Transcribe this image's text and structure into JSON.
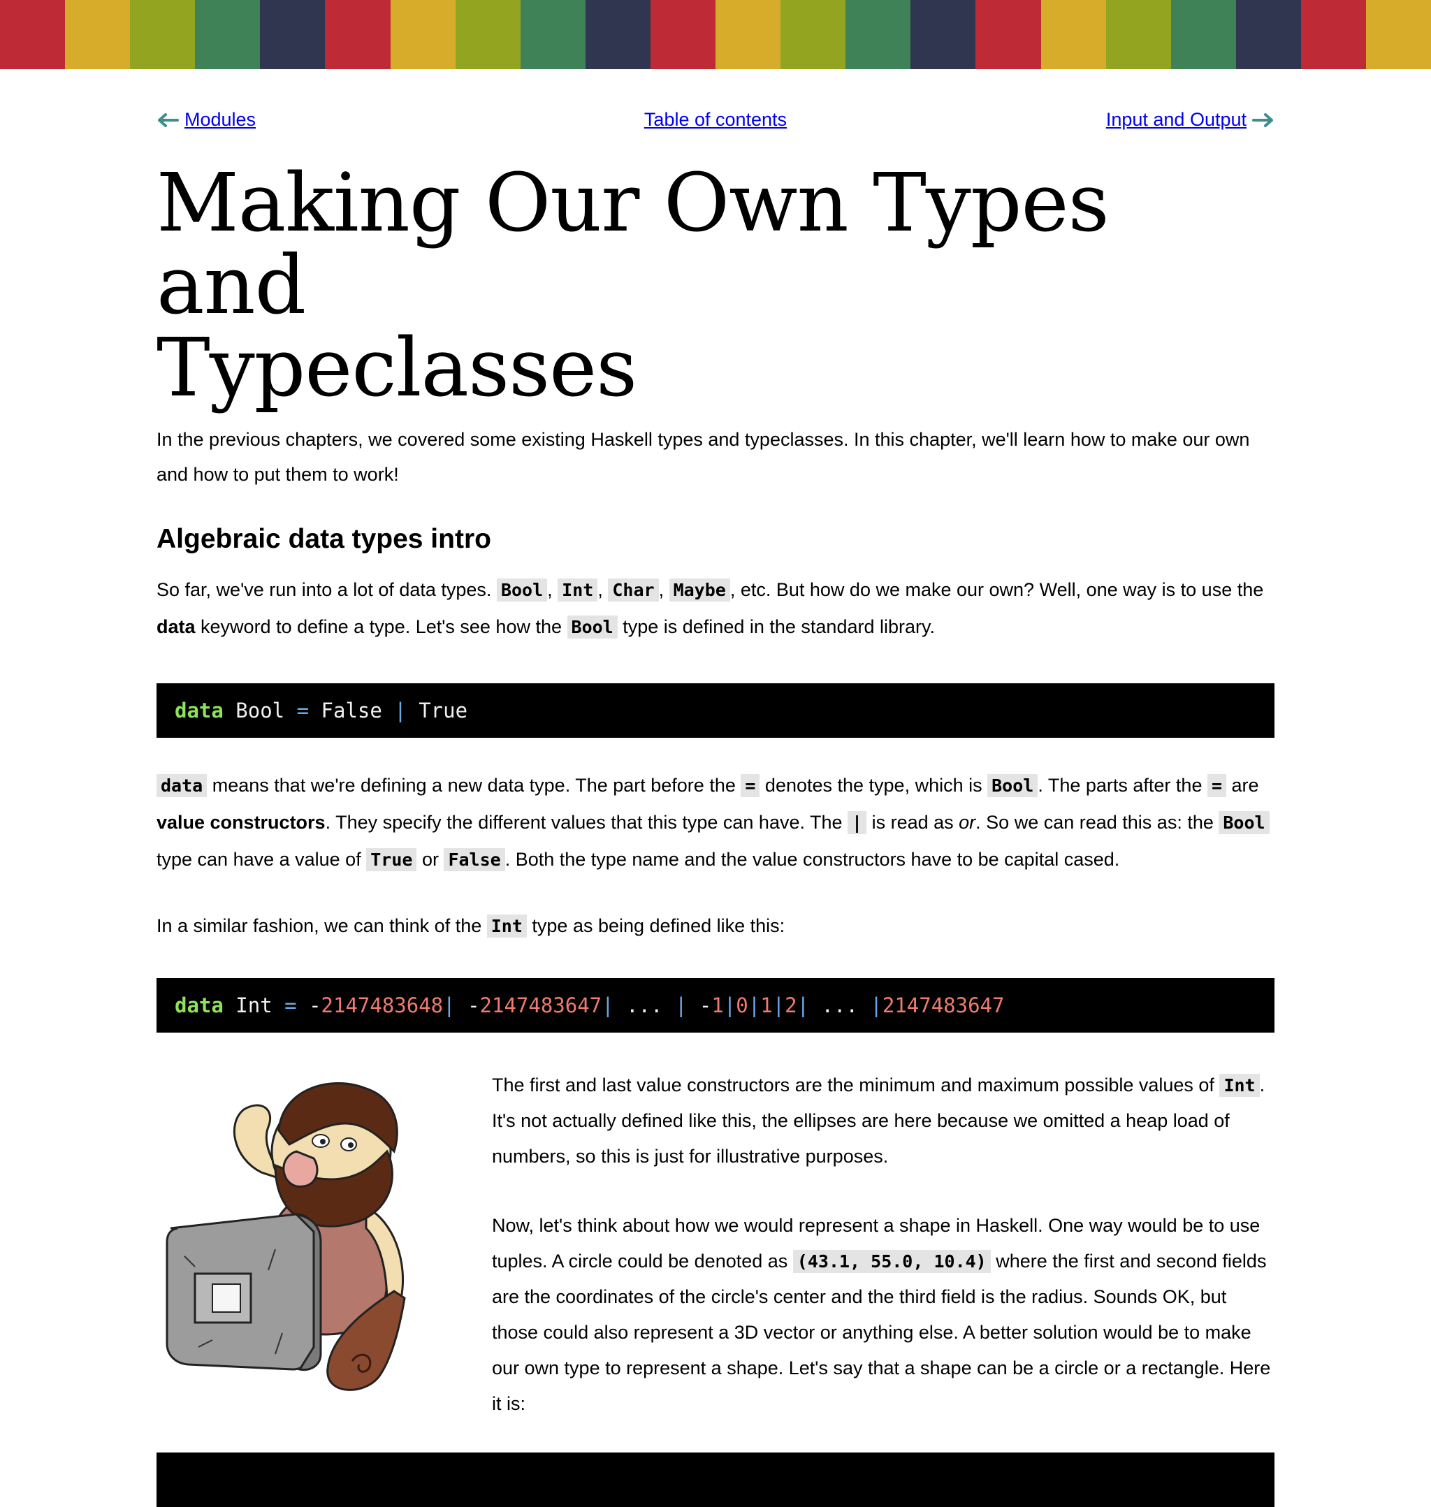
{
  "stripe_colors": [
    "#bf2a37",
    "#d7ac2a",
    "#93a520",
    "#3f8257",
    "#313650",
    "#bf2a37",
    "#d7ac2a",
    "#93a520",
    "#3f8257",
    "#313650",
    "#bf2a37",
    "#d7ac2a",
    "#93a520",
    "#3f8257",
    "#313650",
    "#bf2a37",
    "#d7ac2a",
    "#93a520",
    "#3f8257",
    "#313650",
    "#bf2a37",
    "#d7ac2a"
  ],
  "nav": {
    "prev_label": "Modules",
    "toc_label": "Table of contents",
    "next_label": "Input and Output",
    "arrow_color": "#3d8f8b"
  },
  "title_line1": "Making Our Own Types and",
  "title_line2": "Typeclasses",
  "intro": "In the previous chapters, we covered some existing Haskell types and typeclasses. In this chapter, we'll learn how to make our own and how to put them to work!",
  "section_heading": "Algebraic data types intro",
  "para1": {
    "t1": "So far, we've run into a lot of data types. ",
    "c1": "Bool",
    "s1": ", ",
    "c2": "Int",
    "s2": ", ",
    "c3": "Char",
    "s3": ", ",
    "c4": "Maybe",
    "t2": ", etc. But how do we make our own? Well, one way is to use the ",
    "bold": "data",
    "t3": " keyword to define a type. Let's see how the ",
    "c5": "Bool",
    "t4": " type is defined in the standard library."
  },
  "code1": {
    "kw": "data",
    "t1": " Bool ",
    "eq": "=",
    "t2": " False ",
    "bar": "|",
    "t3": " True"
  },
  "para2": {
    "c1": "data",
    "t1": " means that we're defining a new data type. The part before the ",
    "c2": "=",
    "t2": " denotes the type, which is ",
    "c3": "Bool",
    "t3": ". The parts after the ",
    "c4": "=",
    "t4": " are ",
    "bold": "value constructors",
    "t5": ". They specify the different values that this type can have. The ",
    "c5": "|",
    "t6": " is read as ",
    "em": "or",
    "t7": ". So we can read this as: the ",
    "c6": "Bool",
    "t8": " type can have a value of ",
    "c7": "True",
    "t9": " or ",
    "c8": "False",
    "t10": ". Both the type name and the value constructors have to be capital cased."
  },
  "para3": {
    "t1": "In a similar fashion, we can think of the ",
    "c1": "Int",
    "t2": " type as being defined like this:"
  },
  "code2": {
    "kw": "data",
    "name": " Int ",
    "eq": "=",
    "s1": " -",
    "n1": "2147483648",
    "b1": "|",
    "s2": " -",
    "n2": "2147483647",
    "b2": "|",
    "s3": " ... ",
    "b3": "|",
    "s4": " -",
    "n4": "1",
    "b4": "|",
    "n5": "0",
    "b5": "|",
    "n6": "1",
    "b6": "|",
    "n7": "2",
    "b7": "|",
    "s8": " ... ",
    "b8": "|",
    "n9": "2147483647"
  },
  "para4": {
    "t1": "The first and last value constructors are the minimum and maximum possible values of ",
    "c1": "Int",
    "t2": ". It's not actually defined like this, the ellipses are here because we omitted a heap load of numbers, so this is just for illustrative purposes."
  },
  "para5": {
    "t1": "Now, let's think about how we would represent a shape in Haskell. One way would be to use tuples. A circle could be denoted as ",
    "c1": "(43.1, 55.0, 10.4)",
    "t2": " where the first and second fields are the coordinates of the circle's center and the third field is the radius. Sounds OK, but those could also represent a 3D vector or anything else. A better solution would be to make our own type to represent a shape. Let's say that a shape can be a circle or a rectangle. Here it is:"
  }
}
